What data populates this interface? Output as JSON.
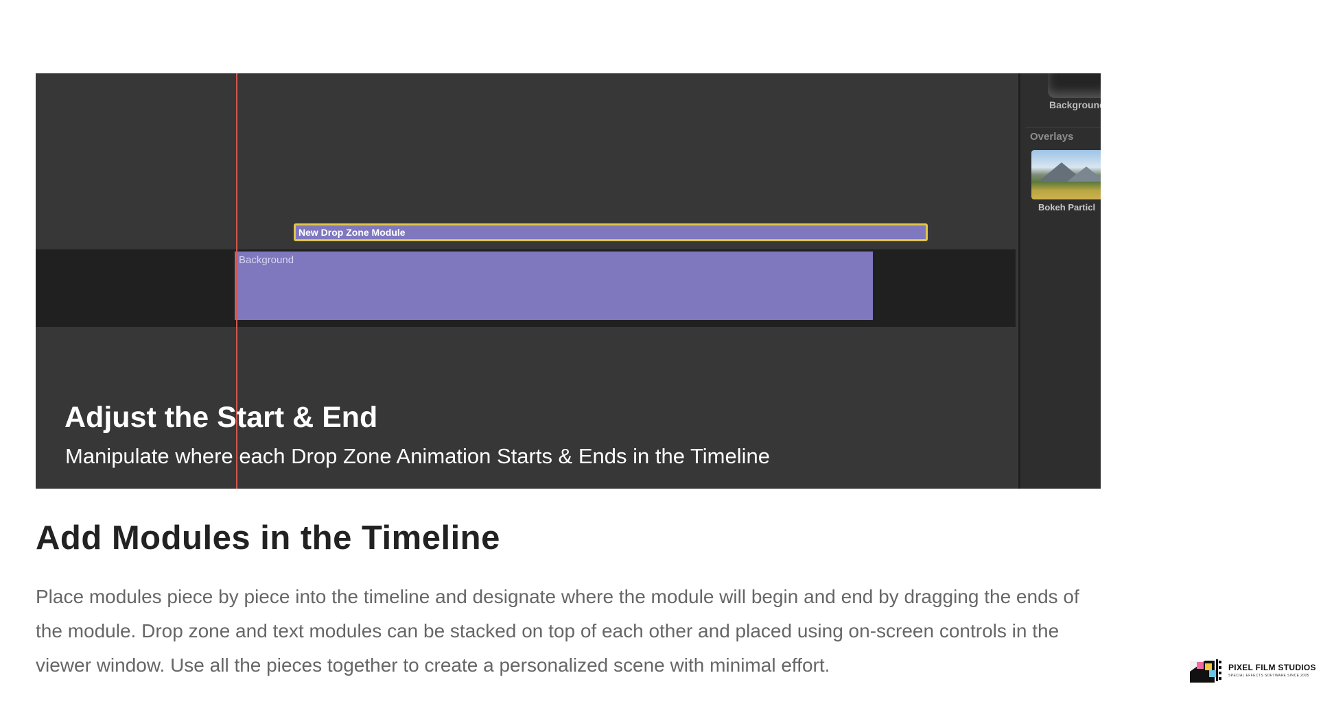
{
  "hero": {
    "clip_new_module": "New Drop Zone Module",
    "clip_background": "Background",
    "side_panel": {
      "background_label": "Background",
      "overlays_header": "Overlays",
      "bokeh_label": "Bokeh Particl"
    },
    "overlay_title": "Adjust the Start & End",
    "overlay_subtitle": "Manipulate where each Drop Zone Animation Starts & Ends in the Timeline"
  },
  "section": {
    "title": "Add Modules in the Timeline",
    "body": "Place modules piece by piece into the timeline and designate where the module will begin and end by dragging the ends of the module. Drop zone and text modules can be stacked on top of each other and placed using on-screen controls in the viewer window. Use all the pieces together to create a personalized scene with minimal effort."
  },
  "logo": {
    "name": "PIXEL FILM STUDIOS",
    "tagline": "SPECIAL EFFECTS SOFTWARE SINCE 2005"
  },
  "colors": {
    "clip_purple": "#7f78bf",
    "selection_yellow": "#e2c64a",
    "playhead_red": "#d4574e"
  }
}
